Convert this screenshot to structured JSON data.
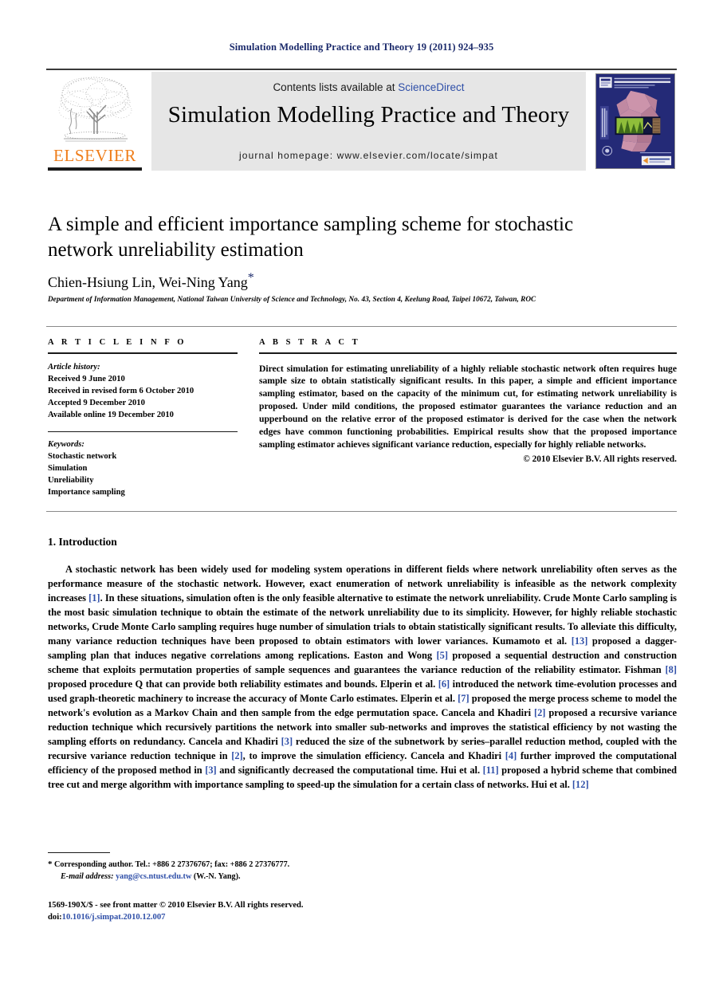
{
  "running_head": "Simulation Modelling Practice and Theory 19 (2011) 924–935",
  "masthead": {
    "publisher_logo_name": "ELSEVIER",
    "contents_prefix": "Contents lists available at ",
    "contents_link": "ScienceDirect",
    "journal_title": "Simulation Modelling Practice and Theory",
    "homepage": "journal homepage: www.elsevier.com/locate/simpat",
    "link_color": "#2f4fa8",
    "panel_color": "#e6e6e6",
    "logo_color": "#ef7d1a",
    "cover_title": "SIMULATION MODELLING PRACTICE AND THEORY"
  },
  "article": {
    "title": "A simple and efficient importance sampling scheme for stochastic network unreliability estimation",
    "authors": "Chien-Hsiung Lin, Wei-Ning Yang",
    "corresponding_marker": "*",
    "affiliation": "Department of Information Management, National Taiwan University of Science and Technology, No. 43, Section 4, Keelung Road, Taipei 10672, Taiwan, ROC"
  },
  "article_info": {
    "heading": "A R T I C L E   I N F O",
    "history_label": "Article history:",
    "history": [
      "Received 9 June 2010",
      "Received in revised form 6 October 2010",
      "Accepted 9 December 2010",
      "Available online 19 December 2010"
    ],
    "keywords_label": "Keywords:",
    "keywords": [
      "Stochastic network",
      "Simulation",
      "Unreliability",
      "Importance sampling"
    ]
  },
  "abstract": {
    "heading": "A B S T R A C T",
    "body": "Direct simulation for estimating unreliability of a highly reliable stochastic network often requires huge sample size to obtain statistically significant results. In this paper, a simple and efficient importance sampling estimator, based on the capacity of the minimum cut, for estimating network unreliability is proposed. Under mild conditions, the proposed estimator guarantees the variance reduction and an upperbound on the relative error of the proposed estimator is derived for the case when the network edges have common functioning probabilities. Empirical results show that the proposed importance sampling estimator achieves significant variance reduction, especially for highly reliable networks.",
    "copyright": "© 2010 Elsevier B.V. All rights reserved."
  },
  "section": {
    "heading": "1. Introduction",
    "paragraph_parts": [
      "A stochastic network has been widely used for modeling system operations in different fields where network unreliability often serves as the performance measure of the stochastic network. However, exact enumeration of network unreliability is infeasible as the network complexity increases ",
      "[1]",
      ". In these situations, simulation often is the only feasible alternative to estimate the network unreliability. Crude Monte Carlo sampling is the most basic simulation technique to obtain the estimate of the network unreliability due to its simplicity. However, for highly reliable stochastic networks, Crude Monte Carlo sampling requires huge number of simulation trials to obtain statistically significant results. To alleviate this difficulty, many variance reduction techniques have been proposed to obtain estimators with lower variances. Kumamoto et al. ",
      "[13]",
      " proposed a dagger-sampling plan that induces negative correlations among replications. Easton and Wong ",
      "[5]",
      " proposed a sequential destruction and construction scheme that exploits permutation properties of sample sequences and guarantees the variance reduction of the reliability estimator. Fishman ",
      "[8]",
      " proposed procedure Q that can provide both reliability estimates and bounds. Elperin et al. ",
      "[6]",
      " introduced the network time-evolution processes and used graph-theoretic machinery to increase the accuracy of Monte Carlo estimates. Elperin et al. ",
      "[7]",
      " proposed the merge process scheme to model the network's evolution as a Markov Chain and then sample from the edge permutation space. Cancela and Khadiri ",
      "[2]",
      " proposed a recursive variance reduction technique which recursively partitions the network into smaller sub-networks and improves the statistical efficiency by not wasting the sampling efforts on redundancy. Cancela and Khadiri ",
      "[3]",
      " reduced the size of the subnetwork by series–parallel reduction method, coupled with the recursive variance reduction technique in ",
      "[2]",
      ", to improve the simulation efficiency. Cancela and Khadiri ",
      "[4]",
      " further improved the computational efficiency of the proposed method in ",
      "[3]",
      " and significantly decreased the computational time. Hui et al. ",
      "[11]",
      " proposed a hybrid scheme that combined tree cut and merge algorithm with importance sampling to speed-up the simulation for a certain class of networks. Hui et al. ",
      "[12]"
    ]
  },
  "footnotes": {
    "corresponding_star": "*",
    "corresponding_text": "Corresponding author. Tel.: +886 2 27376767; fax: +886 2 27376777.",
    "email_label": "E-mail address:",
    "email": "yang@cs.ntust.edu.tw",
    "email_owner": "(W.-N. Yang)."
  },
  "imprint": {
    "line1": "1569-190X/$ - see front matter © 2010 Elsevier B.V. All rights reserved.",
    "doi_label": "doi:",
    "doi_value": "10.1016/j.simpat.2010.12.007"
  }
}
